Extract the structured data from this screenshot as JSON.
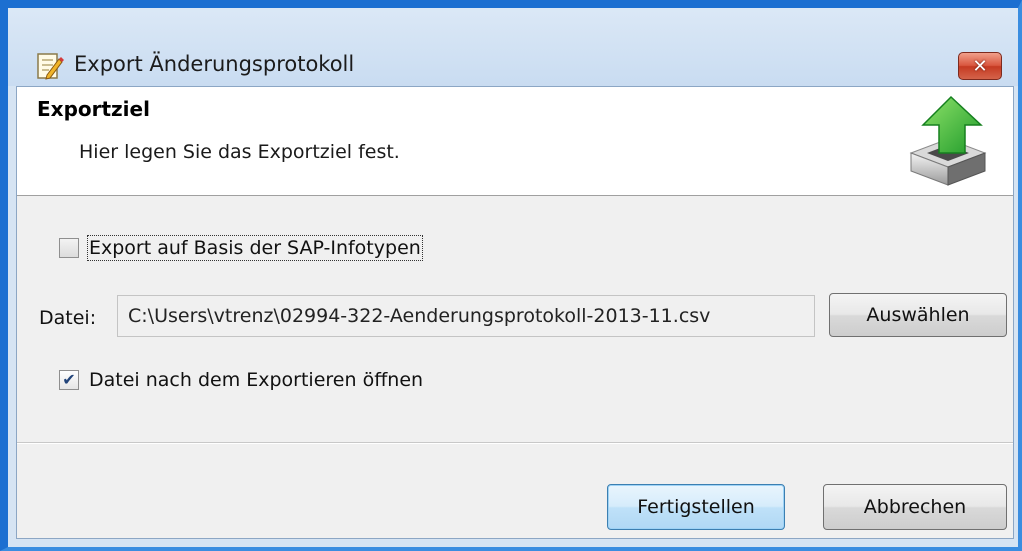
{
  "window": {
    "title": "Export Änderungsprotokoll",
    "close_label": "✕"
  },
  "header": {
    "title": "Exportziel",
    "description": "Hier legen Sie das Exportziel fest."
  },
  "options": {
    "sap_checkbox": {
      "label": "Export auf Basis der SAP-Infotypen",
      "checked": false
    },
    "open_checkbox": {
      "label": "Datei nach dem Exportieren öffnen",
      "checked": true
    }
  },
  "file": {
    "label": "Datei:",
    "value": "C:\\Users\\vtrenz\\02994-322-Aenderungsprotokoll-2013-11.csv",
    "browse_label": "Auswählen"
  },
  "footer": {
    "finish_label": "Fertigstellen",
    "cancel_label": "Abbrechen"
  },
  "icons": {
    "title_icon": "document-edit-icon",
    "header_icon": "export-arrow-icon"
  },
  "colors": {
    "frame": "#1c6fd1",
    "close_button": "#d9573f",
    "arrow_green": "#3bb33b"
  }
}
